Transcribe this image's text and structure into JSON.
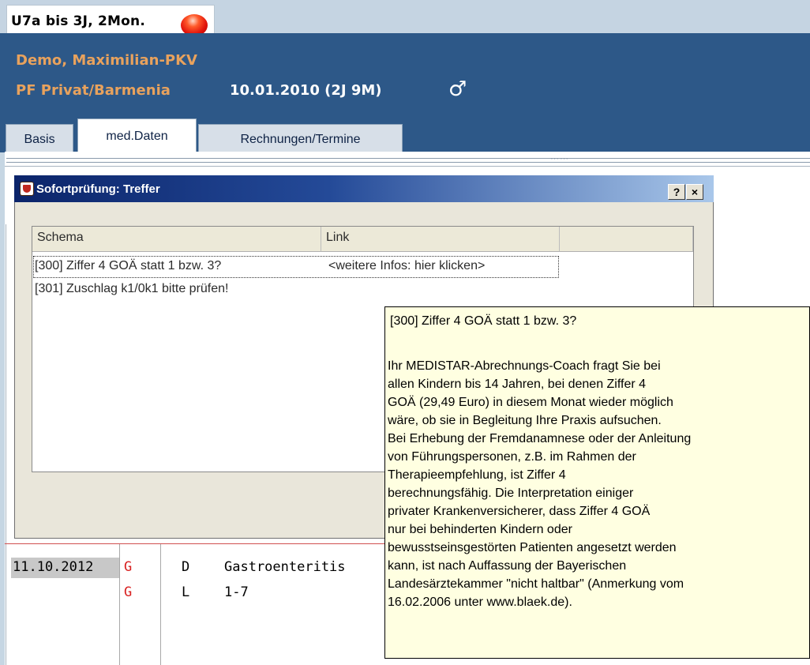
{
  "header": {
    "status_label": "U7a bis 3J, 2Mon.",
    "patient_name": "Demo, Maximilian-PKV",
    "insurance": "PF Privat/Barmenia",
    "birth_info": "10.01.2010 (2J 9M)",
    "sex_symbol": "♂"
  },
  "tabs": [
    {
      "label": "Basis"
    },
    {
      "label": "med.Daten"
    },
    {
      "label": "Rechnungen/Termine"
    }
  ],
  "dialog": {
    "title": "Sofortprüfung: Treffer",
    "help_label": "?",
    "close_label": "×",
    "columns": [
      "Schema",
      "Link"
    ],
    "rows": [
      {
        "schema": "[300] Ziffer 4 GOÄ statt 1 bzw. 3?",
        "link": "<weitere Infos: hier klicken>"
      },
      {
        "schema": "[301] Zuschlag k1/0k1 bitte prüfen!",
        "link": ""
      }
    ]
  },
  "tooltip": {
    "title": "[300] Ziffer 4 GOÄ statt 1 bzw. 3?",
    "lines": [
      "Ihr MEDISTAR-Abrechnungs-Coach fragt Sie bei",
      "allen Kindern bis 14 Jahren, bei denen Ziffer 4",
      "GOÄ (29,49 Euro) in diesem Monat wieder möglich",
      "wäre, ob sie in Begleitung Ihre Praxis aufsuchen.",
      "Bei Erhebung der Fremdanamnese oder der Anleitung",
      "von Führungspersonen, z.B. im Rahmen der",
      "Therapieempfehlung, ist Ziffer 4",
      "berechnungsfähig. Die Interpretation einiger",
      "privater Krankenversicherer, dass Ziffer 4 GOÄ",
      "nur bei behinderten Kindern oder",
      "bewusstseinsgestörten Patienten angesetzt werden",
      "kann, ist nach Auffassung der Bayerischen",
      "Landesärztekammer \"nicht haltbar\" (Anmerkung vom",
      "16.02.2006 unter www.blaek.de)."
    ]
  },
  "records": [
    {
      "date": "11.10.2012",
      "flag": "G",
      "type": "D",
      "text": "Gastroenteritis"
    },
    {
      "date": "",
      "flag": "G",
      "type": "L",
      "text": "1-7"
    }
  ]
}
